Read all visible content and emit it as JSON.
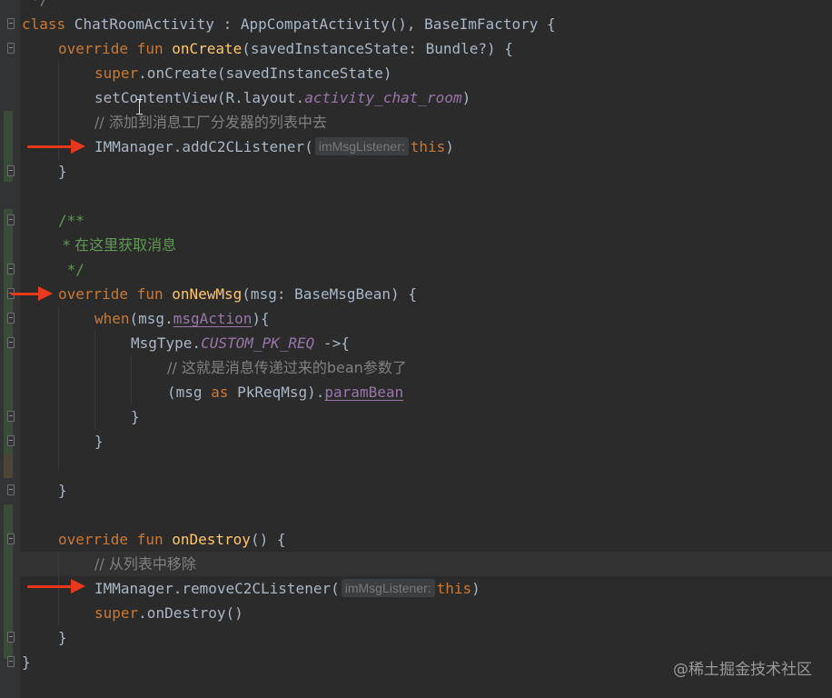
{
  "code": {
    "top_partial": "*/",
    "class_line": {
      "kw": "class",
      "rest": " ChatRoomActivity : AppCompatActivity(), BaseImFactory {"
    },
    "oncreate": {
      "kw": "override fun ",
      "name": "onCreate",
      "params": "(savedInstanceState: Bundle?) {"
    },
    "super_oncreate": {
      "kw": "super",
      "rest": ".onCreate(savedInstanceState)"
    },
    "set_content_view": {
      "pre": "setContentView(R.layout.",
      "field": "activity_chat_room",
      "post": ")"
    },
    "comment_add": "// 添加到消息工厂分发器的列表中去",
    "add_listener": {
      "call": "IMManager.addC2CListener(",
      "hint": "imMsgListener:",
      "arg": "this",
      "close": ")"
    },
    "close_brace": "}",
    "doc_open": "/**",
    "doc_text": " * 在这里获取消息",
    "doc_close": " */",
    "onnewmsg": {
      "kw": "override fun ",
      "name": "onNewMsg",
      "params": "(msg: BaseMsgBean) {"
    },
    "when_line": {
      "kw": "when",
      "pre": "(msg.",
      "field": "msgAction",
      "post": "){"
    },
    "msgtype_line": {
      "pre": "MsgType.",
      "field": "CUSTOM_PK_REQ",
      "post": " ->{"
    },
    "comment_bean": "// 这就是消息传递过来的bean参数了",
    "cast_line": {
      "pre": "(msg ",
      "kw": "as",
      "mid": " PkReqMsg).",
      "field": "paramBean"
    },
    "ondestroy": {
      "kw": "override fun ",
      "name": "onDestroy",
      "params": "() {"
    },
    "comment_remove": "// 从列表中移除",
    "remove_listener": {
      "call": "IMManager.removeC2CListener(",
      "hint": "imMsgListener:",
      "arg": "this",
      "close": ")"
    },
    "super_ondestroy": {
      "kw": "super",
      "rest": ".onDestroy()"
    }
  },
  "watermark": "@稀土掘金技术社区",
  "colors": {
    "background": "#2b2b2b",
    "keyword": "#cc7832",
    "function": "#ffc66d",
    "field": "#9876aa",
    "comment": "#808080",
    "doc_comment": "#629755",
    "arrow": "#e8391d"
  },
  "icons": [
    "red-arrow-icon",
    "text-cursor-icon",
    "fold-marker-icon"
  ]
}
